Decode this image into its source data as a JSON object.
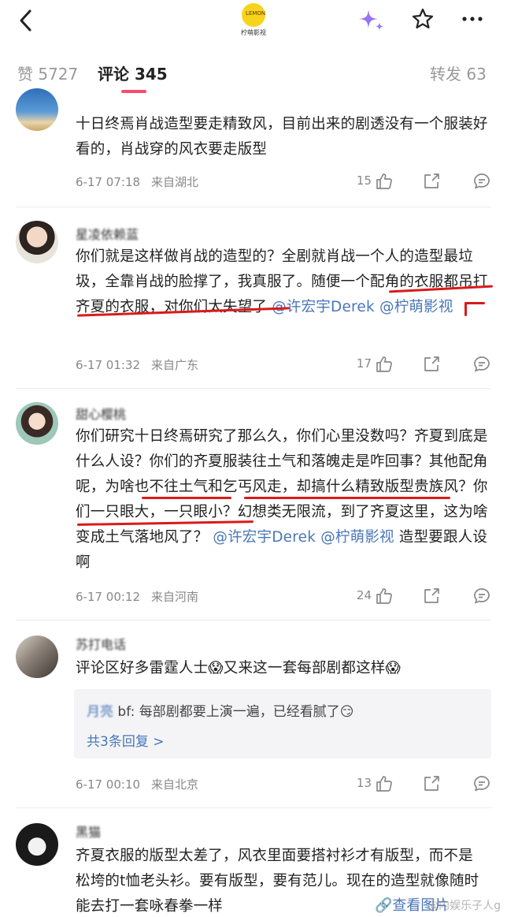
{
  "header": {
    "logo_text": "柠萌影视",
    "logo_badge": "LEMON"
  },
  "tabs": {
    "likes": "赞 5727",
    "comments": "评论 345",
    "reposts": "转发 63"
  },
  "comments": [
    {
      "username": "",
      "text": "十日终焉肖战造型要走精致风，目前出来的剧透没有一个服装好看的，肖战穿的风衣要走版型",
      "time": "6-17 07:18",
      "location": "来自湖北",
      "likes": "15"
    },
    {
      "username": "星凌依赖蓝",
      "text_a": "你们就是这样做肖战的造型的？全剧就肖战一个人的造型最垃圾，全靠肖战的脸撑了，我真服了。随便一个配角的衣服都吊打齐夏的衣服，对你们太失望了",
      "mention_1": "@许宏宇Derek",
      "mention_2": "@柠萌影视",
      "time": "6-17 01:32",
      "location": "来自广东",
      "likes": "17"
    },
    {
      "username": "甜心樱桃",
      "text_a": "你们研究十日终焉研究了那么久，你们心里没数吗？齐夏到底是什么人设？你们的齐夏服装往土气和落魄走是咋回事？其他配角呢，为啥也不往土气和乞丐风走，却搞什么精致版型贵族风？你们一只眼大，一只眼小？幻想类无限流，到了齐夏这里，这为啥变成土气落地风了？",
      "mention_1": "@许宏宇Derek",
      "mention_2": "@柠萌影视",
      "text_b": "造型要跟人设啊",
      "time": "6-17 00:12",
      "location": "来自河南",
      "likes": "24"
    },
    {
      "username": "苏打电话",
      "text": "评论区好多雷霆人士😱又来这一套每部剧都这样😱",
      "reply_user": "月亮",
      "reply_text": "bf: 每部剧都要上演一遍，已经看腻了😏",
      "reply_count": "共3条回复 >",
      "time": "6-17 00:10",
      "location": "来自北京",
      "likes": "13"
    },
    {
      "username": "黑猫",
      "text": "齐夏衣服的版型太差了，风衣里面要搭衬衫才有版型，而不是松垮的t恤老头衫。要有版型，要有范儿。现在的造型就像随时能去打一套咏春拳一样",
      "view_image": "查看图片"
    }
  ],
  "watermark": "@内娱乐子人g"
}
